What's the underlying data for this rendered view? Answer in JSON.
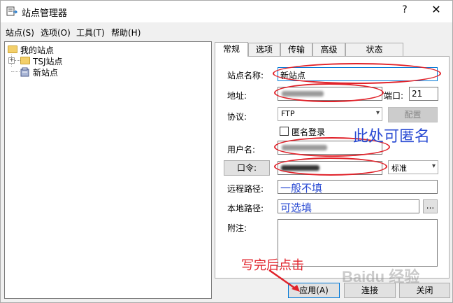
{
  "window": {
    "title": "站点管理器",
    "help_glyph": "?",
    "close_glyph": "✕"
  },
  "menu": {
    "items": [
      "站点(S)",
      "选项(O)",
      "工具(T)",
      "帮助(H)"
    ]
  },
  "tree": {
    "root": "我的站点",
    "children": [
      {
        "label": "TSJ站点",
        "expander": "+"
      },
      {
        "label": "新站点"
      }
    ]
  },
  "tabs": [
    "常规",
    "选项",
    "传输",
    "高级",
    "状态"
  ],
  "form": {
    "site_name_label": "站点名称:",
    "site_name_value": "新站点",
    "address_label": "地址:",
    "port_label": "端口:",
    "port_value": "21",
    "protocol_label": "协议:",
    "protocol_value": "FTP",
    "config_button": "配置",
    "anonymous_label": "匿名登录",
    "username_label": "用户名:",
    "password_button": "口令:",
    "password_mode": "标准",
    "remote_path_label": "远程路径:",
    "remote_path_value": "一般不填",
    "local_path_label": "本地路径:",
    "local_path_value": "可选填",
    "browse_button": "...",
    "note_label": "附注:"
  },
  "annotations": {
    "anonymous_hint": "此处可匿名",
    "apply_hint": "写完后点击",
    "watermark": "Baidu 经验"
  },
  "buttons": {
    "apply": "应用(A)",
    "connect": "连接",
    "close": "关闭"
  },
  "colors": {
    "annotation_red": "#e0222a",
    "hint_blue": "#2a4bd3",
    "focus_blue": "#0078d7"
  }
}
